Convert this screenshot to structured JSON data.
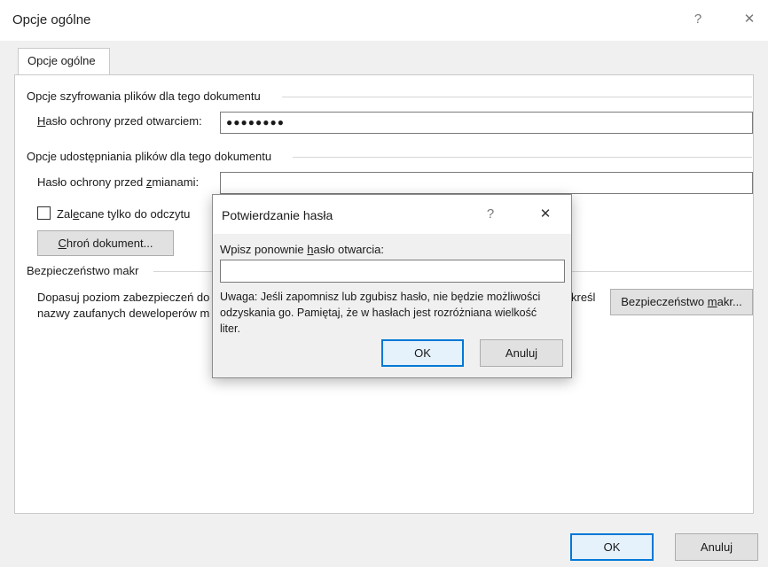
{
  "window": {
    "title": "Opcje ogólne",
    "help_glyph": "?",
    "close_glyph": "✕"
  },
  "tabs": [
    {
      "label": "Opcje ogólne"
    }
  ],
  "encryption": {
    "group_label": "Opcje szyfrowania plików dla tego dokumentu",
    "open_password_label": "Hasło ochrony przed otwarciem:",
    "open_password_value": "●●●●●●●●"
  },
  "sharing": {
    "group_label": "Opcje udostępniania plików dla tego dokumentu",
    "modify_password_label": "Hasło ochrony przed zmianami:",
    "modify_password_value": "",
    "readonly_label": "Zalecane tylko do odczytu",
    "readonly_checked": false,
    "protect_button": "Chroń dokument..."
  },
  "macro": {
    "group_label": "Bezpieczeństwo makr",
    "description_line1": "Dopasuj poziom zabezpieczeń do",
    "description_line2": "nazwy zaufanych deweloperów m",
    "description_suffix": "kreśl",
    "button": "Bezpieczeństwo makr..."
  },
  "footer": {
    "ok": "OK",
    "cancel": "Anuluj"
  },
  "confirm_dialog": {
    "title": "Potwierdzanie hasła",
    "help_glyph": "?",
    "close_glyph": "✕",
    "prompt": "Wpisz ponownie hasło otwarcia:",
    "input_value": "",
    "note_line1": "Uwaga: Jeśli zapomnisz lub zgubisz hasło, nie będzie możliwości",
    "note_line2": "odzyskania go. Pamiętaj, że w hasłach jest rozróżniana wielkość",
    "note_line3": "liter.",
    "ok": "OK",
    "cancel": "Anuluj"
  }
}
